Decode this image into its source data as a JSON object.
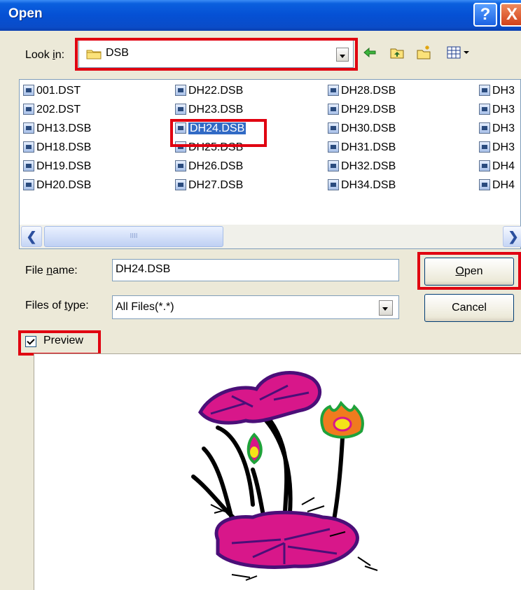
{
  "window": {
    "title": "Open",
    "help_button": "?",
    "close_button": "X"
  },
  "look_in": {
    "label_prefix": "Look ",
    "label_accel": "i",
    "label_suffix": "n:",
    "value": "DSB"
  },
  "files": [
    {
      "name": "001.DST"
    },
    {
      "name": "202.DST"
    },
    {
      "name": "DH13.DSB"
    },
    {
      "name": "DH18.DSB"
    },
    {
      "name": "DH19.DSB"
    },
    {
      "name": "DH20.DSB"
    },
    {
      "name": "DH22.DSB"
    },
    {
      "name": "DH23.DSB"
    },
    {
      "name": "DH24.DSB",
      "selected": true
    },
    {
      "name": "DH25.DSB"
    },
    {
      "name": "DH26.DSB"
    },
    {
      "name": "DH27.DSB"
    },
    {
      "name": "DH28.DSB"
    },
    {
      "name": "DH29.DSB"
    },
    {
      "name": "DH30.DSB"
    },
    {
      "name": "DH31.DSB"
    },
    {
      "name": "DH32.DSB"
    },
    {
      "name": "DH34.DSB"
    },
    {
      "name": "DH3"
    },
    {
      "name": "DH3"
    },
    {
      "name": "DH3"
    },
    {
      "name": "DH3"
    },
    {
      "name": "DH4"
    },
    {
      "name": "DH4"
    }
  ],
  "scrollbar": {
    "thumb_grip": "IIII"
  },
  "file_name": {
    "label_prefix": "File ",
    "label_accel": "n",
    "label_suffix": "ame:",
    "value": "DH24.DSB"
  },
  "files_of_type": {
    "label_prefix": "Files of ",
    "label_accel": "t",
    "label_suffix": "ype:",
    "value": "All Files(*.*)"
  },
  "buttons": {
    "open_accel": "O",
    "open_rest": "pen",
    "cancel": "Cancel"
  },
  "preview": {
    "label": "Preview",
    "checked": true
  },
  "colors": {
    "highlight": "#e00010",
    "selection": "#316ac5",
    "flower_pink": "#d8178a",
    "flower_purple": "#4a0f78",
    "flower_orange": "#f07b1e",
    "flower_yellow": "#f3e418",
    "flower_green": "#1fa23a"
  }
}
